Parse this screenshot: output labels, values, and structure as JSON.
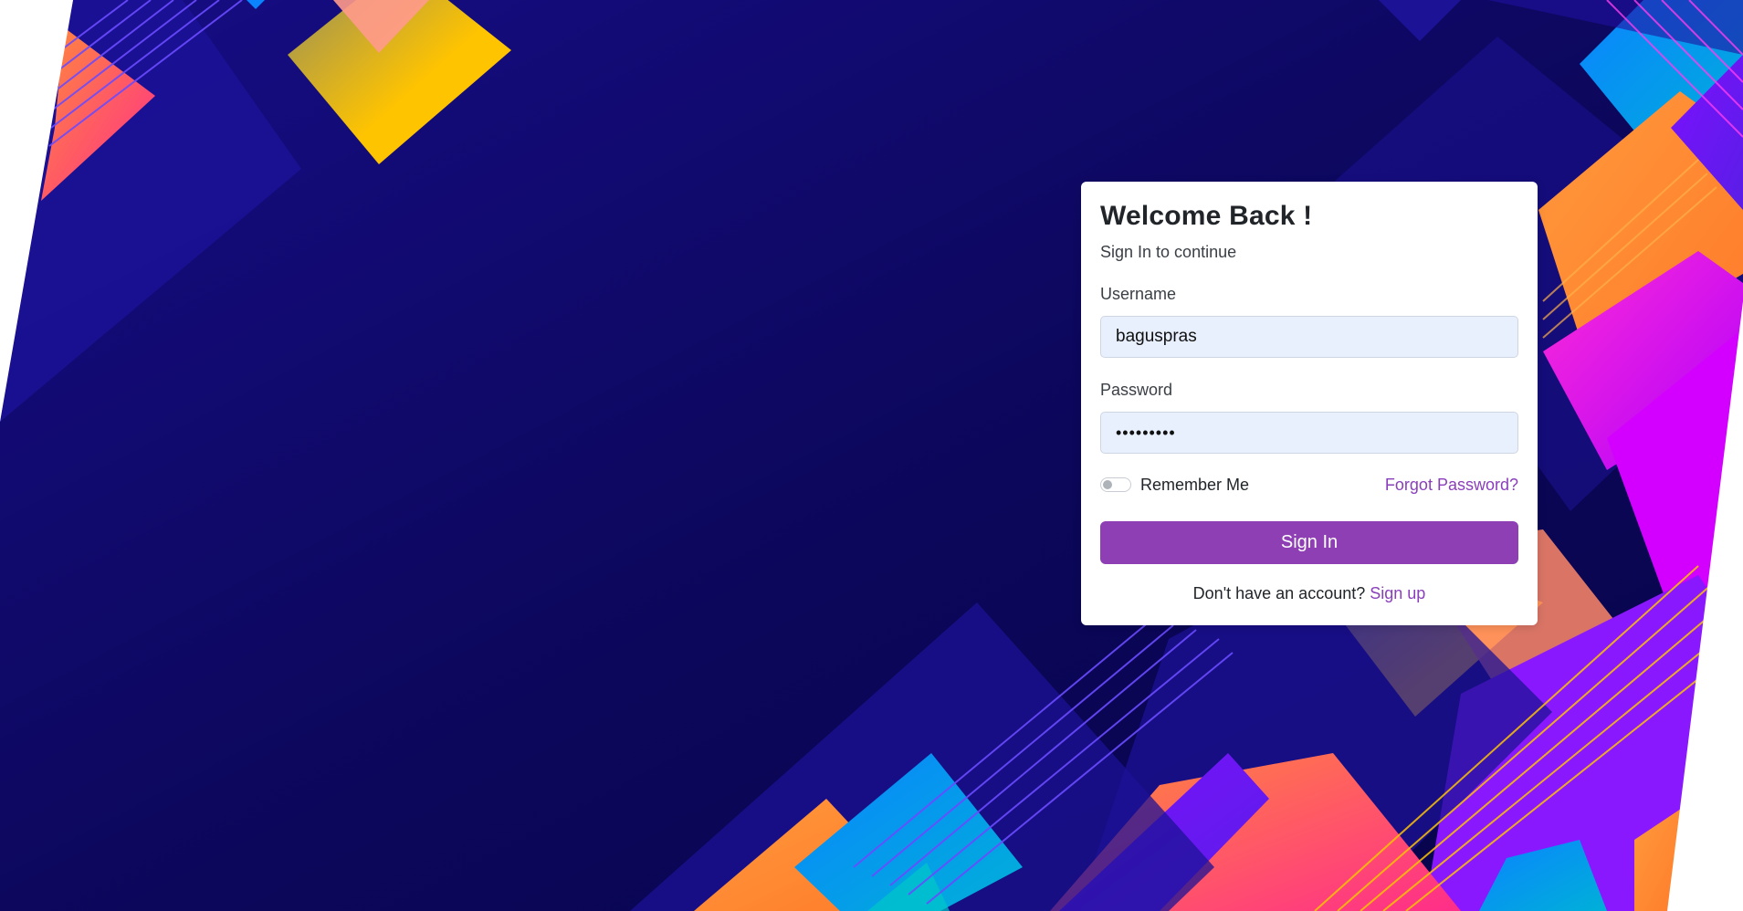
{
  "login": {
    "title": "Welcome Back !",
    "subtitle": "Sign In to continue",
    "username_label": "Username",
    "username_value": "baguspras",
    "password_label": "Password",
    "password_masked": "•••••••••",
    "remember_label": "Remember Me",
    "remember_checked": false,
    "forgot_label": "Forgot Password?",
    "signin_label": "Sign In",
    "signup_prompt": "Don't have an account?",
    "signup_label": "Sign up"
  },
  "colors": {
    "background_navy": "#0d0660",
    "accent_purple": "#8e3fb3",
    "link_purple": "#8a3fba",
    "input_bg": "#e8f0fe"
  },
  "icons": {
    "toggle": "switch-off-icon"
  }
}
